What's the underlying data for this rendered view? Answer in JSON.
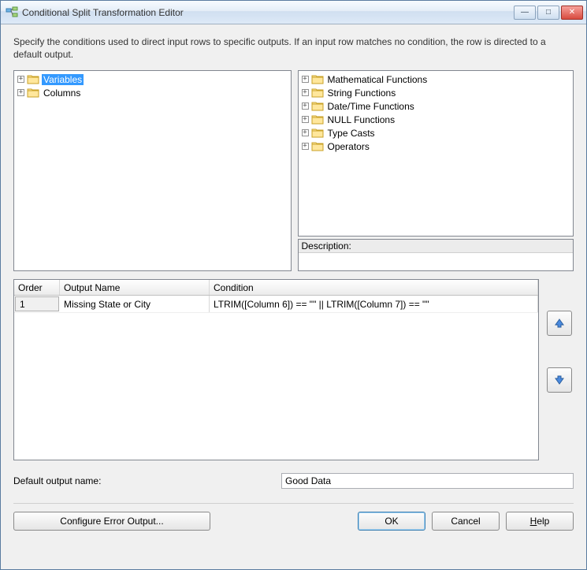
{
  "window": {
    "title": "Conditional Split Transformation Editor"
  },
  "description": "Specify the conditions used to direct input rows to specific outputs. If an input row matches no condition, the row is directed to a default output.",
  "leftTree": {
    "items": [
      {
        "label": "Variables",
        "selected": true
      },
      {
        "label": "Columns",
        "selected": false
      }
    ]
  },
  "rightTree": {
    "items": [
      {
        "label": "Mathematical Functions"
      },
      {
        "label": "String Functions"
      },
      {
        "label": "Date/Time Functions"
      },
      {
        "label": "NULL Functions"
      },
      {
        "label": "Type Casts"
      },
      {
        "label": "Operators"
      }
    ]
  },
  "descriptionPanel": {
    "header": "Description:",
    "body": ""
  },
  "grid": {
    "columns": {
      "order": "Order",
      "outputName": "Output Name",
      "condition": "Condition"
    },
    "rows": [
      {
        "order": "1",
        "outputName": "Missing State or City",
        "condition": "LTRIM([Column 6]) == \"\" || LTRIM([Column 7]) == \"\""
      }
    ]
  },
  "defaultOutput": {
    "label": "Default output name:",
    "value": "Good Data"
  },
  "buttons": {
    "configureError": "Configure Error Output...",
    "ok": "OK",
    "cancel": "Cancel",
    "help": "Help"
  },
  "icons": {
    "minimize": "—",
    "maximize": "□",
    "close": "✕",
    "expander": "+",
    "arrowUp": "▲",
    "arrowDown": "▼"
  }
}
